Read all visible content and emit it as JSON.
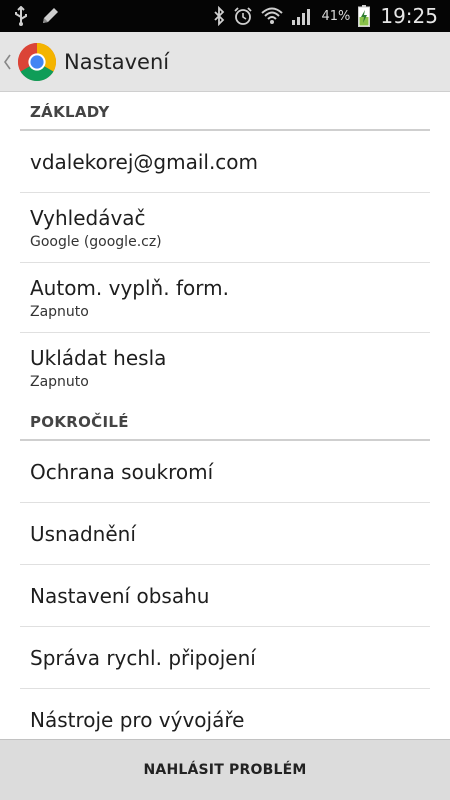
{
  "status_bar": {
    "battery_percent": "41%",
    "time": "19:25",
    "icons": [
      "usb-icon",
      "pencil-icon",
      "bluetooth-icon",
      "alarm-icon",
      "wifi-icon",
      "signal-icon",
      "battery-charging-icon"
    ]
  },
  "action_bar": {
    "title": "Nastavení",
    "logo": "chrome-logo"
  },
  "sections": [
    {
      "header": "ZÁKLADY",
      "items": [
        {
          "title": "vdalekorej@gmail.com",
          "summary": ""
        },
        {
          "title": "Vyhledávač",
          "summary": "Google (google.cz)"
        },
        {
          "title": "Autom. vyplň. form.",
          "summary": "Zapnuto"
        },
        {
          "title": "Ukládat hesla",
          "summary": "Zapnuto"
        }
      ]
    },
    {
      "header": "POKROČILÉ",
      "items": [
        {
          "title": "Ochrana soukromí"
        },
        {
          "title": "Usnadnění"
        },
        {
          "title": "Nastavení obsahu"
        },
        {
          "title": "Správa rychl. připojení"
        },
        {
          "title": "Nástroje pro vývojáře"
        }
      ]
    }
  ],
  "bottom_bar": {
    "report_label": "NAHLÁSIT PROBLÉM"
  },
  "colors": {
    "status_bar_bg": "#050505",
    "action_bar_bg": "#e5e5e5",
    "bottom_bar_bg": "#dcdcdc",
    "divider": "#cfcfcf"
  }
}
